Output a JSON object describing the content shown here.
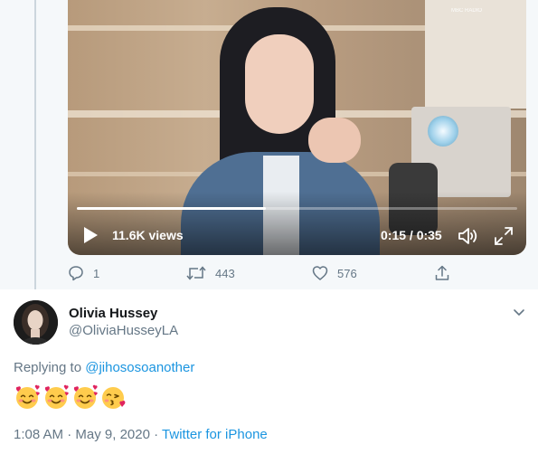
{
  "video": {
    "views": "11.6K views",
    "time": "0:15 / 0:35",
    "progress": 0.43,
    "play_icon": "play-icon",
    "volume_icon": "volume-icon",
    "fullscreen_icon": "fullscreen-icon",
    "badge_text": "MBC RADIO"
  },
  "actions": {
    "reply_count": "1",
    "retweet_count": "443",
    "like_count": "576"
  },
  "reply": {
    "name": "Olivia Hussey",
    "handle": "@OliviaHusseyLA",
    "replying_prefix": "Replying to",
    "replying_handle": "@jihososoanother",
    "emojis": [
      "smiling-face-with-hearts",
      "smiling-face-with-hearts",
      "smiling-face-with-hearts",
      "face-blowing-a-kiss"
    ],
    "time": "1:08 AM",
    "date": "May 9, 2020",
    "source": "Twitter for iPhone",
    "separator": "·"
  },
  "colors": {
    "link": "#1b95e0",
    "secondary": "#657786",
    "background": "#f5f8fa"
  }
}
